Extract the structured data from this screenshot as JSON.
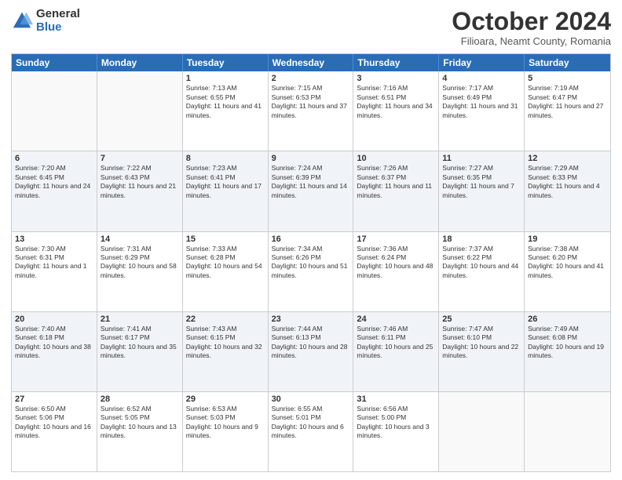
{
  "logo": {
    "general": "General",
    "blue": "Blue"
  },
  "title": "October 2024",
  "subtitle": "Filioara, Neamt County, Romania",
  "header_days": [
    "Sunday",
    "Monday",
    "Tuesday",
    "Wednesday",
    "Thursday",
    "Friday",
    "Saturday"
  ],
  "weeks": [
    [
      {
        "day": "",
        "sunrise": "",
        "sunset": "",
        "daylight": "",
        "empty": true
      },
      {
        "day": "",
        "sunrise": "",
        "sunset": "",
        "daylight": "",
        "empty": true
      },
      {
        "day": "1",
        "sunrise": "Sunrise: 7:13 AM",
        "sunset": "Sunset: 6:55 PM",
        "daylight": "Daylight: 11 hours and 41 minutes."
      },
      {
        "day": "2",
        "sunrise": "Sunrise: 7:15 AM",
        "sunset": "Sunset: 6:53 PM",
        "daylight": "Daylight: 11 hours and 37 minutes."
      },
      {
        "day": "3",
        "sunrise": "Sunrise: 7:16 AM",
        "sunset": "Sunset: 6:51 PM",
        "daylight": "Daylight: 11 hours and 34 minutes."
      },
      {
        "day": "4",
        "sunrise": "Sunrise: 7:17 AM",
        "sunset": "Sunset: 6:49 PM",
        "daylight": "Daylight: 11 hours and 31 minutes."
      },
      {
        "day": "5",
        "sunrise": "Sunrise: 7:19 AM",
        "sunset": "Sunset: 6:47 PM",
        "daylight": "Daylight: 11 hours and 27 minutes."
      }
    ],
    [
      {
        "day": "6",
        "sunrise": "Sunrise: 7:20 AM",
        "sunset": "Sunset: 6:45 PM",
        "daylight": "Daylight: 11 hours and 24 minutes."
      },
      {
        "day": "7",
        "sunrise": "Sunrise: 7:22 AM",
        "sunset": "Sunset: 6:43 PM",
        "daylight": "Daylight: 11 hours and 21 minutes."
      },
      {
        "day": "8",
        "sunrise": "Sunrise: 7:23 AM",
        "sunset": "Sunset: 6:41 PM",
        "daylight": "Daylight: 11 hours and 17 minutes."
      },
      {
        "day": "9",
        "sunrise": "Sunrise: 7:24 AM",
        "sunset": "Sunset: 6:39 PM",
        "daylight": "Daylight: 11 hours and 14 minutes."
      },
      {
        "day": "10",
        "sunrise": "Sunrise: 7:26 AM",
        "sunset": "Sunset: 6:37 PM",
        "daylight": "Daylight: 11 hours and 11 minutes."
      },
      {
        "day": "11",
        "sunrise": "Sunrise: 7:27 AM",
        "sunset": "Sunset: 6:35 PM",
        "daylight": "Daylight: 11 hours and 7 minutes."
      },
      {
        "day": "12",
        "sunrise": "Sunrise: 7:29 AM",
        "sunset": "Sunset: 6:33 PM",
        "daylight": "Daylight: 11 hours and 4 minutes."
      }
    ],
    [
      {
        "day": "13",
        "sunrise": "Sunrise: 7:30 AM",
        "sunset": "Sunset: 6:31 PM",
        "daylight": "Daylight: 11 hours and 1 minute."
      },
      {
        "day": "14",
        "sunrise": "Sunrise: 7:31 AM",
        "sunset": "Sunset: 6:29 PM",
        "daylight": "Daylight: 10 hours and 58 minutes."
      },
      {
        "day": "15",
        "sunrise": "Sunrise: 7:33 AM",
        "sunset": "Sunset: 6:28 PM",
        "daylight": "Daylight: 10 hours and 54 minutes."
      },
      {
        "day": "16",
        "sunrise": "Sunrise: 7:34 AM",
        "sunset": "Sunset: 6:26 PM",
        "daylight": "Daylight: 10 hours and 51 minutes."
      },
      {
        "day": "17",
        "sunrise": "Sunrise: 7:36 AM",
        "sunset": "Sunset: 6:24 PM",
        "daylight": "Daylight: 10 hours and 48 minutes."
      },
      {
        "day": "18",
        "sunrise": "Sunrise: 7:37 AM",
        "sunset": "Sunset: 6:22 PM",
        "daylight": "Daylight: 10 hours and 44 minutes."
      },
      {
        "day": "19",
        "sunrise": "Sunrise: 7:38 AM",
        "sunset": "Sunset: 6:20 PM",
        "daylight": "Daylight: 10 hours and 41 minutes."
      }
    ],
    [
      {
        "day": "20",
        "sunrise": "Sunrise: 7:40 AM",
        "sunset": "Sunset: 6:18 PM",
        "daylight": "Daylight: 10 hours and 38 minutes."
      },
      {
        "day": "21",
        "sunrise": "Sunrise: 7:41 AM",
        "sunset": "Sunset: 6:17 PM",
        "daylight": "Daylight: 10 hours and 35 minutes."
      },
      {
        "day": "22",
        "sunrise": "Sunrise: 7:43 AM",
        "sunset": "Sunset: 6:15 PM",
        "daylight": "Daylight: 10 hours and 32 minutes."
      },
      {
        "day": "23",
        "sunrise": "Sunrise: 7:44 AM",
        "sunset": "Sunset: 6:13 PM",
        "daylight": "Daylight: 10 hours and 28 minutes."
      },
      {
        "day": "24",
        "sunrise": "Sunrise: 7:46 AM",
        "sunset": "Sunset: 6:11 PM",
        "daylight": "Daylight: 10 hours and 25 minutes."
      },
      {
        "day": "25",
        "sunrise": "Sunrise: 7:47 AM",
        "sunset": "Sunset: 6:10 PM",
        "daylight": "Daylight: 10 hours and 22 minutes."
      },
      {
        "day": "26",
        "sunrise": "Sunrise: 7:49 AM",
        "sunset": "Sunset: 6:08 PM",
        "daylight": "Daylight: 10 hours and 19 minutes."
      }
    ],
    [
      {
        "day": "27",
        "sunrise": "Sunrise: 6:50 AM",
        "sunset": "Sunset: 5:06 PM",
        "daylight": "Daylight: 10 hours and 16 minutes."
      },
      {
        "day": "28",
        "sunrise": "Sunrise: 6:52 AM",
        "sunset": "Sunset: 5:05 PM",
        "daylight": "Daylight: 10 hours and 13 minutes."
      },
      {
        "day": "29",
        "sunrise": "Sunrise: 6:53 AM",
        "sunset": "Sunset: 5:03 PM",
        "daylight": "Daylight: 10 hours and 9 minutes."
      },
      {
        "day": "30",
        "sunrise": "Sunrise: 6:55 AM",
        "sunset": "Sunset: 5:01 PM",
        "daylight": "Daylight: 10 hours and 6 minutes."
      },
      {
        "day": "31",
        "sunrise": "Sunrise: 6:56 AM",
        "sunset": "Sunset: 5:00 PM",
        "daylight": "Daylight: 10 hours and 3 minutes."
      },
      {
        "day": "",
        "sunrise": "",
        "sunset": "",
        "daylight": "",
        "empty": true
      },
      {
        "day": "",
        "sunrise": "",
        "sunset": "",
        "daylight": "",
        "empty": true
      }
    ]
  ]
}
